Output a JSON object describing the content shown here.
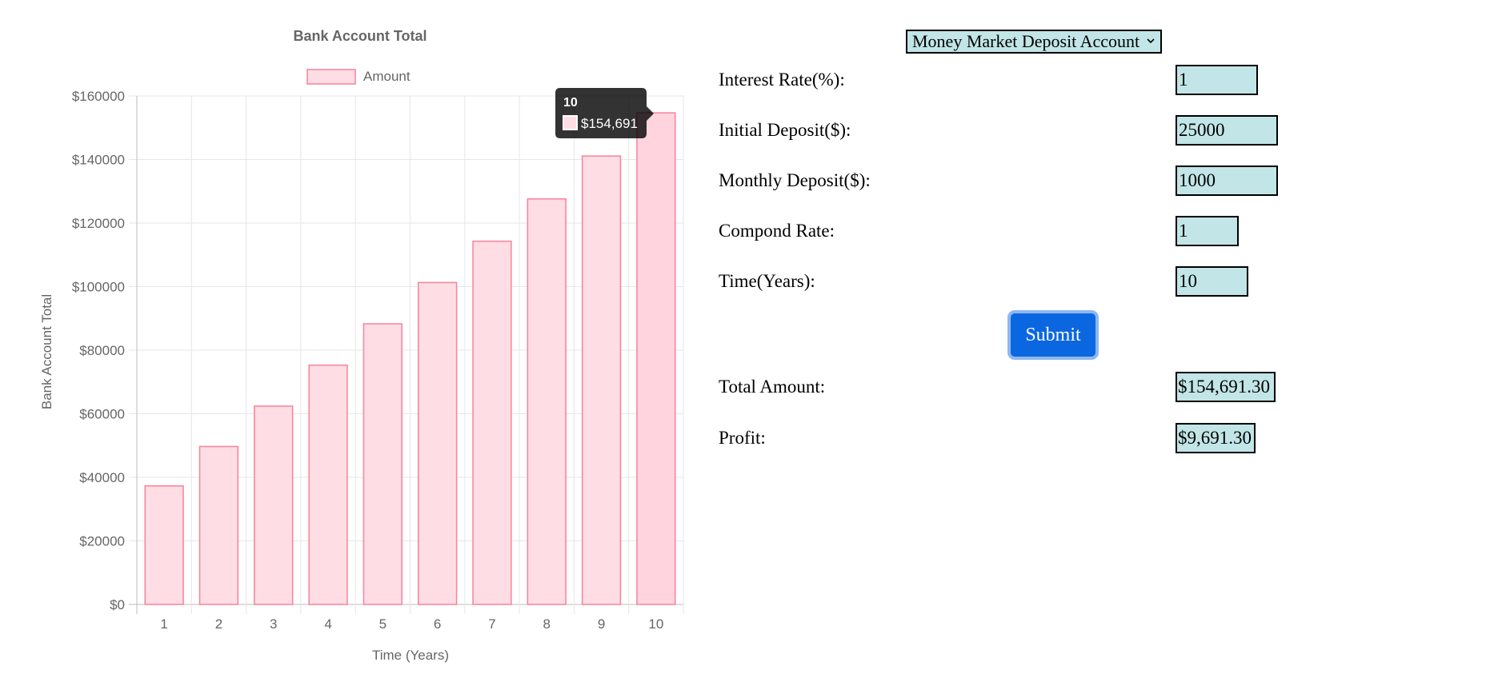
{
  "chart_data": {
    "type": "bar",
    "title": "Bank Account Total",
    "xlabel": "Time (Years)",
    "ylabel": "Bank Account Total",
    "categories": [
      "1",
      "2",
      "3",
      "4",
      "5",
      "6",
      "7",
      "8",
      "9",
      "10"
    ],
    "series": [
      {
        "name": "Amount",
        "values": [
          37300,
          49700,
          62400,
          75300,
          88300,
          101300,
          114300,
          127600,
          141100,
          154691.3
        ],
        "fill": "#ffdde4",
        "stroke": "#f7829b"
      }
    ],
    "ylim": [
      0,
      160000
    ],
    "yticks": [
      "$0",
      "$20000",
      "$40000",
      "$60000",
      "$80000",
      "$100000",
      "$120000",
      "$140000",
      "$160000"
    ],
    "legend_position": "top",
    "grid": true,
    "tooltip": {
      "title": "10",
      "value_label": "$154,691"
    },
    "highlighted_category": "10",
    "highlight_fill": "#ffd4df"
  },
  "form": {
    "account_type": "Money Market Deposit Account",
    "interest_rate_label": "Interest Rate(%):",
    "interest_rate": "1",
    "initial_deposit_label": "Initial Deposit($):",
    "initial_deposit": "25000",
    "monthly_deposit_label": "Monthly Deposit($):",
    "monthly_deposit": "1000",
    "compound_rate_label": "Compond Rate:",
    "compound_rate": "1",
    "time_label": "Time(Years):",
    "time": "10",
    "submit_label": "Submit",
    "total_amount_label": "Total Amount:",
    "total_amount": "$154,691.30",
    "profit_label": "Profit:",
    "profit": "$9,691.30"
  },
  "colors": {
    "field_background": "#c2e5e7",
    "button_background": "#0b67e0",
    "button_border": "#8db7f2"
  }
}
